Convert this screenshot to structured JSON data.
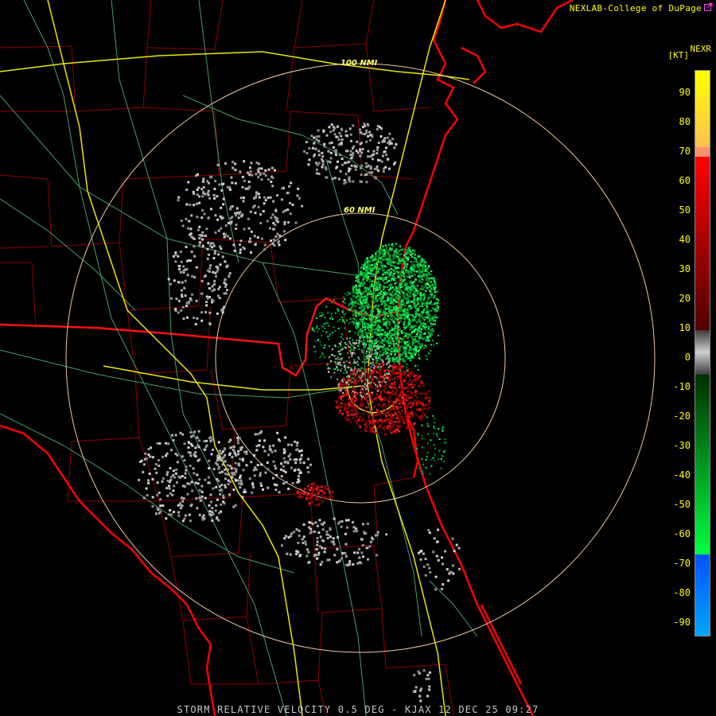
{
  "header": {
    "credit": "NEXLAB-College of DuPage",
    "credit_icon": "external-link-icon",
    "product": "NEXR",
    "unit": "[KT]"
  },
  "rings": {
    "outer_label": "100 NMI",
    "inner_label": "60 NMI"
  },
  "footer": {
    "caption": "STORM RELATIVE VELOCITY 0.5 DEG - KJAX 12 DEC 25 09:27"
  },
  "scale": {
    "ticks": [
      "90",
      "80",
      "70",
      "60",
      "50",
      "40",
      "30",
      "20",
      "10",
      "0",
      "-10",
      "-20",
      "-30",
      "-40",
      "-50",
      "-60",
      "-70",
      "-80",
      "-90"
    ],
    "colors": {
      "high_yellow": "#ffff00",
      "orange": "#ffa060",
      "red": "#ff0000",
      "dark_red": "#600000",
      "gray": "#a0a0a0",
      "dark_green": "#006000",
      "green": "#00ff40",
      "blue": "#0060ff",
      "light_blue": "#00a8ff"
    }
  },
  "map_colors": {
    "coast": "#ff0000",
    "county": "#b00000",
    "state": "#ff2020",
    "interstate": "#ffff00",
    "highway": "#60c080",
    "range_ring": "#f0c8a0"
  }
}
